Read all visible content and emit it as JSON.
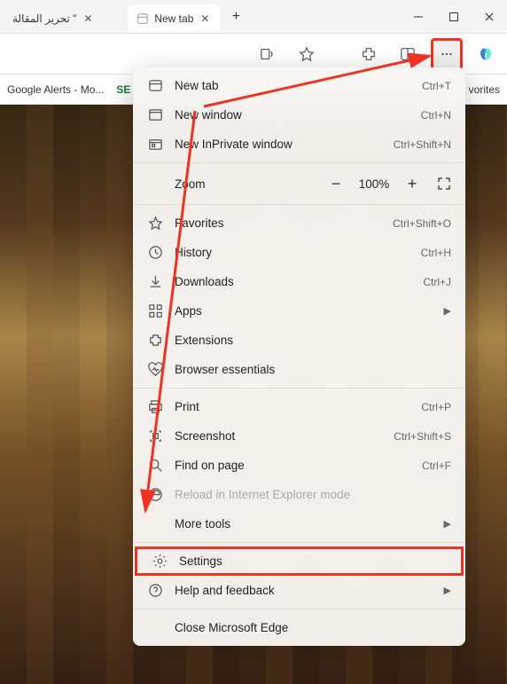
{
  "tabs": [
    {
      "title": "تحرير المقالة \""
    },
    {
      "title": "New tab"
    }
  ],
  "bookmarks": {
    "item1": "Google Alerts - Mo...",
    "item2": "SE",
    "right": "vorites"
  },
  "menu": {
    "new_tab": {
      "label": "New tab",
      "shortcut": "Ctrl+T"
    },
    "new_window": {
      "label": "New window",
      "shortcut": "Ctrl+N"
    },
    "inprivate": {
      "label": "New InPrivate window",
      "shortcut": "Ctrl+Shift+N"
    },
    "zoom": {
      "label": "Zoom",
      "pct": "100%"
    },
    "favorites": {
      "label": "Favorites",
      "shortcut": "Ctrl+Shift+O"
    },
    "history": {
      "label": "History",
      "shortcut": "Ctrl+H"
    },
    "downloads": {
      "label": "Downloads",
      "shortcut": "Ctrl+J"
    },
    "apps": {
      "label": "Apps"
    },
    "extensions": {
      "label": "Extensions"
    },
    "essentials": {
      "label": "Browser essentials"
    },
    "print": {
      "label": "Print",
      "shortcut": "Ctrl+P"
    },
    "screenshot": {
      "label": "Screenshot",
      "shortcut": "Ctrl+Shift+S"
    },
    "find": {
      "label": "Find on page",
      "shortcut": "Ctrl+F"
    },
    "reload_ie": {
      "label": "Reload in Internet Explorer mode"
    },
    "more_tools": {
      "label": "More tools"
    },
    "settings": {
      "label": "Settings"
    },
    "help": {
      "label": "Help and feedback"
    },
    "close_edge": {
      "label": "Close Microsoft Edge"
    }
  }
}
